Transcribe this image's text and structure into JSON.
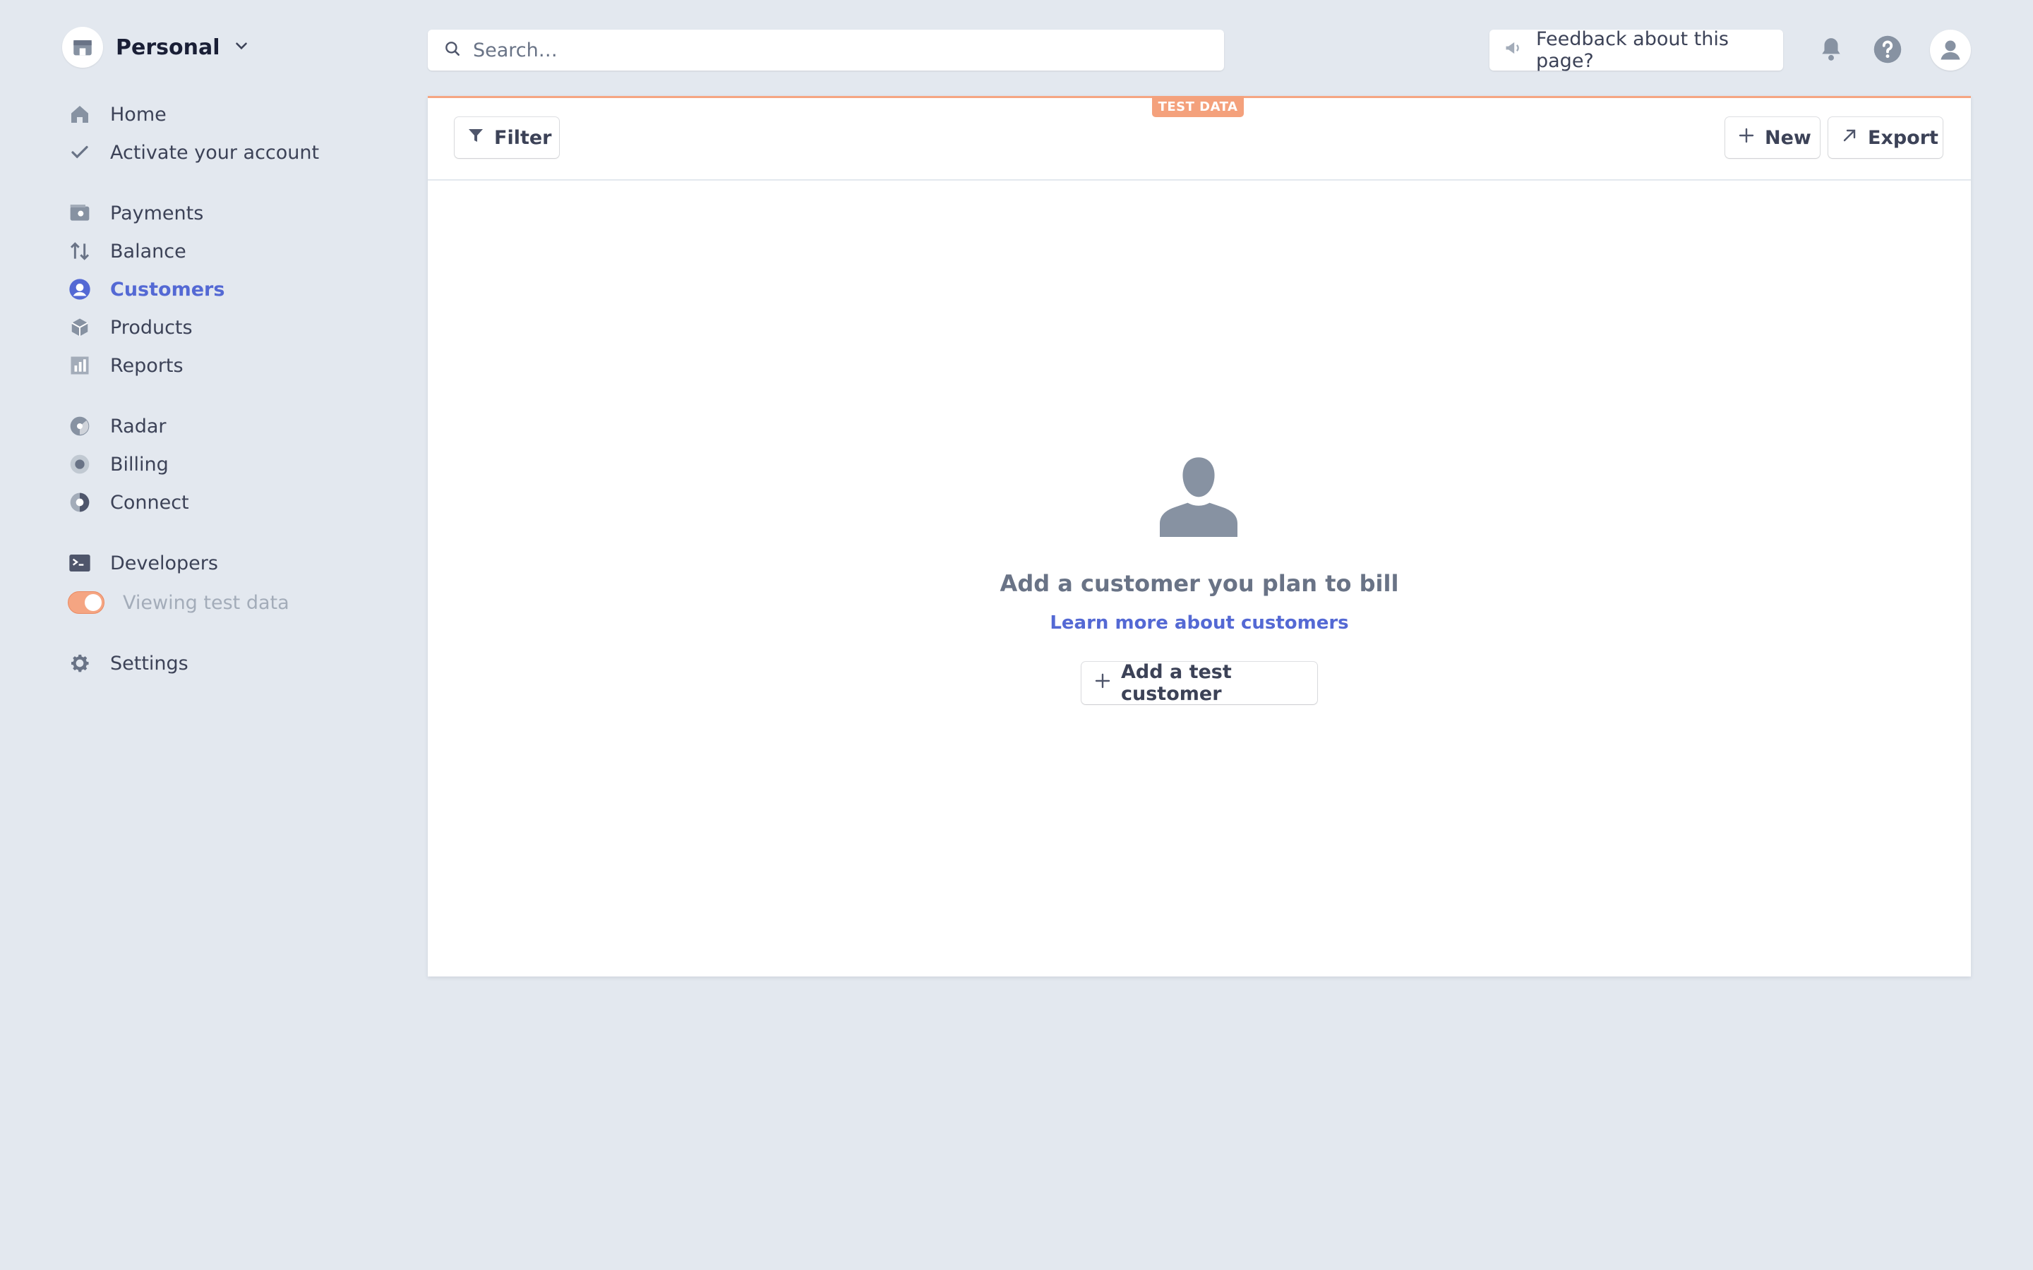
{
  "account": {
    "name": "Personal",
    "logo_icon": "store-icon",
    "chevron_icon": "chevron-down-icon"
  },
  "sidebar": {
    "items": [
      {
        "label": "Home",
        "icon": "home-icon"
      },
      {
        "label": "Activate your account",
        "icon": "check-icon"
      },
      {
        "label": "Payments",
        "icon": "payments-icon"
      },
      {
        "label": "Balance",
        "icon": "balance-arrows-icon"
      },
      {
        "label": "Customers",
        "icon": "customer-icon",
        "active": true
      },
      {
        "label": "Products",
        "icon": "product-box-icon"
      },
      {
        "label": "Reports",
        "icon": "reports-icon"
      },
      {
        "label": "Radar",
        "icon": "radar-icon"
      },
      {
        "label": "Billing",
        "icon": "billing-icon"
      },
      {
        "label": "Connect",
        "icon": "connect-icon"
      },
      {
        "label": "Developers",
        "icon": "terminal-icon"
      },
      {
        "label": "Viewing test data",
        "icon": "toggle"
      },
      {
        "label": "Settings",
        "icon": "gear-icon"
      }
    ]
  },
  "search": {
    "placeholder": "Search…"
  },
  "feedback": {
    "label": "Feedback about this page?",
    "icon": "megaphone-icon"
  },
  "topbar_icons": [
    "bell-icon",
    "help-icon",
    "user-avatar-icon"
  ],
  "badge": {
    "label": "TEST DATA"
  },
  "toolbar": {
    "filter_label": "Filter",
    "new_label": "New",
    "export_label": "Export"
  },
  "empty_state": {
    "title": "Add a customer you plan to bill",
    "link": "Learn more about customers",
    "button": "Add a test customer"
  },
  "colors": {
    "accent": "#5469d4",
    "test_mode": "#f4a17c",
    "background": "#e3e8ef"
  }
}
